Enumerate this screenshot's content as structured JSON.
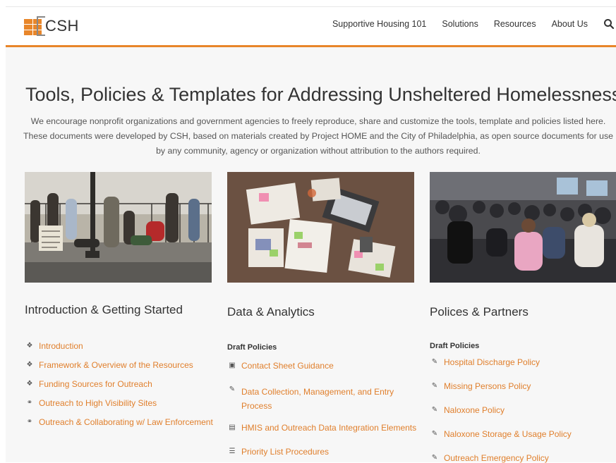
{
  "header": {
    "logo_text": "CSH",
    "brand_colors": {
      "orange": "#e8862a",
      "gray": "#888888"
    },
    "nav": [
      "Supportive Housing 101",
      "Solutions",
      "Resources",
      "About Us"
    ]
  },
  "page": {
    "title": "Tools, Policies & Templates for Addressing Unsheltered Homelessness",
    "intro_lines": [
      "We encourage nonprofit organizations and government agencies to freely reproduce, share and customize the tools, template and policies listed here.",
      "These documents were developed by CSH, based on materials created by Project HOME and the City of Philadelphia, as open source documents for use",
      "by any community, agency or organization without attribution to the authors required."
    ]
  },
  "columns": [
    {
      "title": "Introduction & Getting Started",
      "items": [
        {
          "icon": "info-icon",
          "label": "Introduction"
        },
        {
          "icon": "info-icon",
          "label": "Framework & Overview of the Resources"
        },
        {
          "icon": "info-icon",
          "label": "Funding Sources for Outreach"
        },
        {
          "icon": "handshake-icon",
          "label": "Outreach to High Visibility Sites"
        },
        {
          "icon": "handshake-icon",
          "label": "Outreach & Collaborating w/ Law Enforcement"
        }
      ]
    },
    {
      "title": "Data & Analytics",
      "subheading": "Draft Policies",
      "items": [
        {
          "icon": "form-icon",
          "label": "Contact Sheet Guidance"
        },
        {
          "icon": "edit-icon",
          "label": "Data Collection, Management, and Entry",
          "label2": "Process"
        },
        {
          "icon": "document-icon",
          "label": "HMIS and Outreach Data Integration Elements"
        },
        {
          "icon": "list-icon",
          "label": "Priority List Procedures"
        }
      ]
    },
    {
      "title": "Polices & Partners",
      "subheading": "Draft Policies",
      "items": [
        {
          "icon": "edit-icon",
          "label": "Hospital Discharge Policy"
        },
        {
          "icon": "edit-icon",
          "label": "Missing Persons Policy"
        },
        {
          "icon": "edit-icon",
          "label": "Naloxone Policy"
        },
        {
          "icon": "edit-icon",
          "label": "Naloxone Storage & Usage Policy"
        },
        {
          "icon": "edit-icon",
          "label": "Outreach Emergency Policy"
        }
      ]
    }
  ],
  "images": [
    "homeless-outreach-photo",
    "data-analytics-photo",
    "conference-photo"
  ]
}
